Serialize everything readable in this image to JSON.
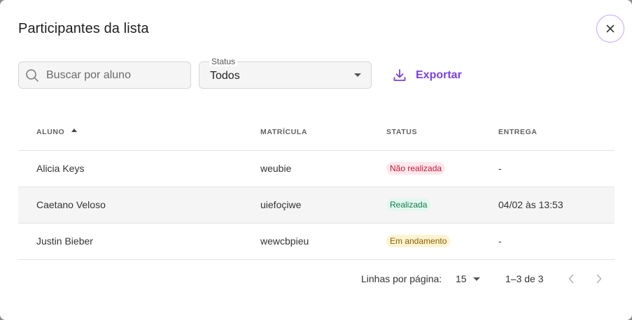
{
  "modal": {
    "title": "Participantes da lista",
    "close_icon": "close-icon"
  },
  "filters": {
    "search_placeholder": "Buscar por aluno",
    "search_value": "",
    "status_label": "Status",
    "status_value": "Todos",
    "export_label": "Exportar"
  },
  "table": {
    "headers": {
      "aluno": "ALUNO",
      "matricula": "MATRÍCULA",
      "status": "STATUS",
      "entrega": "ENTREGA"
    },
    "sort": {
      "column": "ALUNO",
      "direction": "asc"
    },
    "rows": [
      {
        "aluno": "Alicia Keys",
        "matricula": "weubie",
        "status": "Não realizada",
        "status_color": "#c4173a",
        "entrega": "-"
      },
      {
        "aluno": "Caetano Veloso",
        "matricula": "uiefoçiwe",
        "status": "Realizada",
        "status_color": "#137a4e",
        "entrega": "04/02 às 13:53"
      },
      {
        "aluno": "Justin Bieber",
        "matricula": "wewcbpieu",
        "status": "Em andamento",
        "status_color": "#8a6200",
        "entrega": "-"
      }
    ]
  },
  "pagination": {
    "rows_per_page_label": "Linhas por página:",
    "rows_per_page_value": "15",
    "range": "1–3 de 3"
  },
  "colors": {
    "accent": "#7b3fe4",
    "close_border": "#c7a6f2"
  }
}
